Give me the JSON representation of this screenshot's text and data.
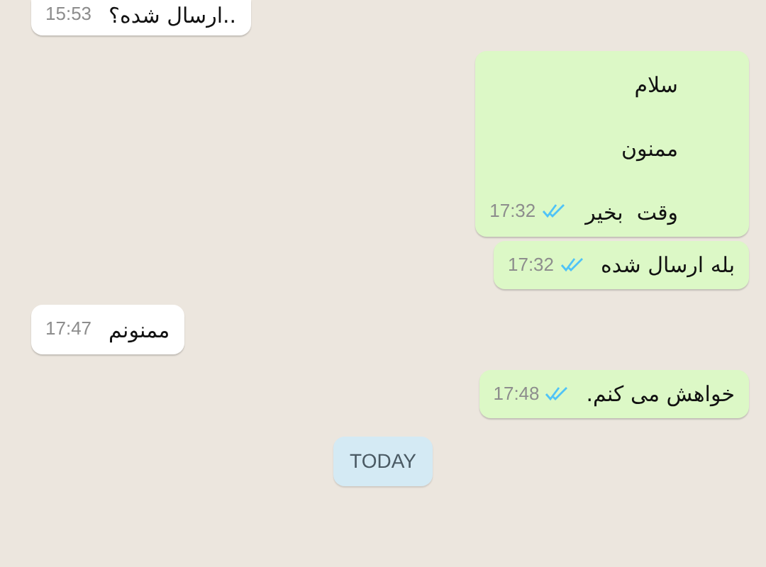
{
  "messages": [
    {
      "kind": "in",
      "lines": [
        "..ارسال شده؟"
      ],
      "time": "15:53"
    },
    {
      "kind": "out",
      "lines": [
        "سلام",
        "ممنون",
        "وقت  بخیر"
      ],
      "time": "17:32",
      "read": true
    },
    {
      "kind": "out",
      "lines": [
        "بله ارسال شده"
      ],
      "time": "17:32",
      "read": true
    },
    {
      "kind": "in",
      "lines": [
        "ممنونم"
      ],
      "time": "17:47"
    },
    {
      "kind": "out",
      "lines": [
        "خواهش می کنم."
      ],
      "time": "17:48",
      "read": true
    }
  ],
  "date_chip": "TODAY"
}
